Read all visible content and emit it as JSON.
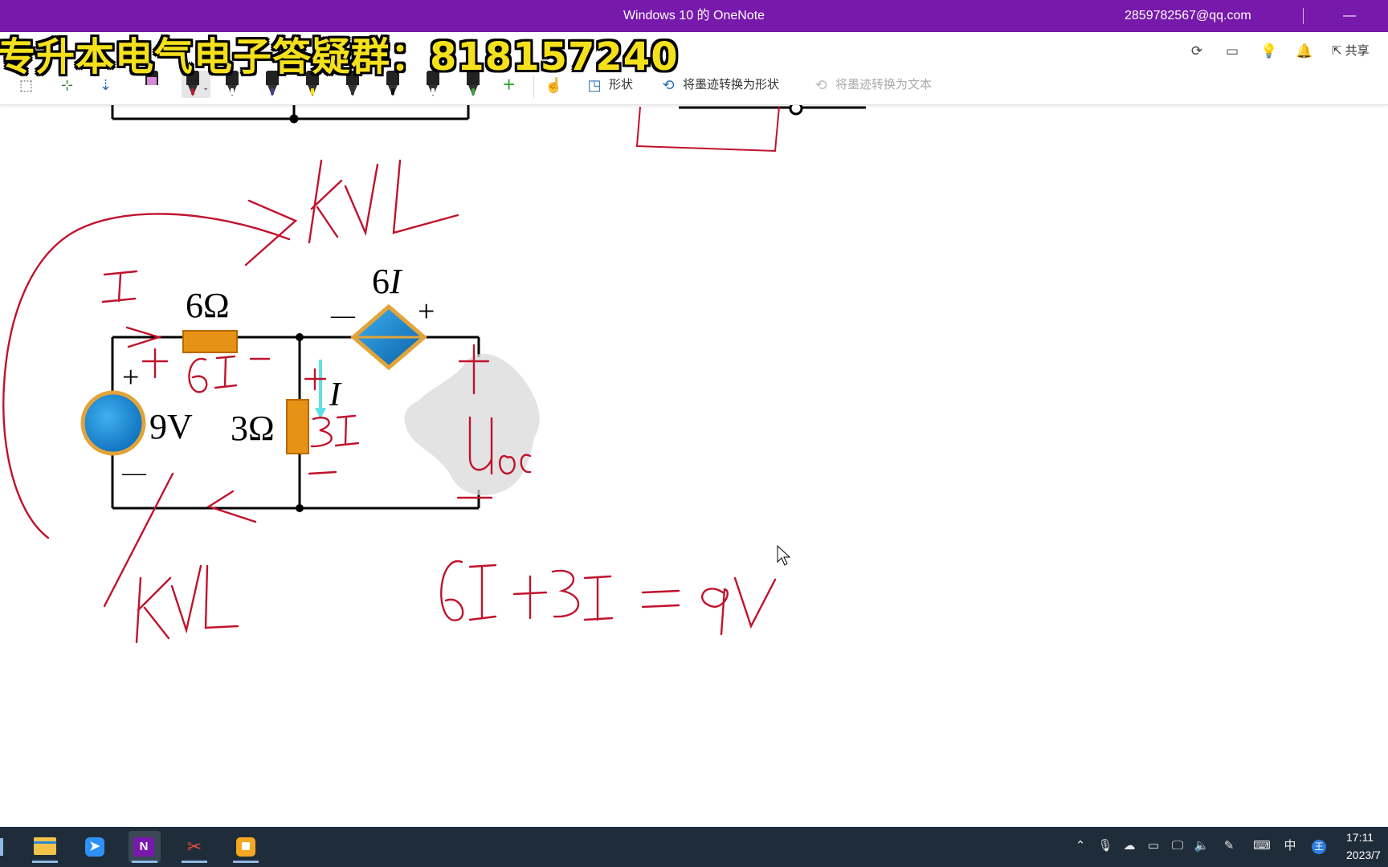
{
  "window": {
    "title": "Windows 10 的 OneNote",
    "account": "2859782567@qq.com",
    "minimize_glyph": "—"
  },
  "top_icons": [
    "sync-icon",
    "page-view-icon",
    "lightbulb-icon",
    "bell-icon"
  ],
  "share_label": "共享",
  "overlay_banner": "专升本电气电子答疑群：818157240",
  "ribbon": {
    "pens": [
      {
        "name": "lasso-select",
        "color": "#555555"
      },
      {
        "name": "space-insert",
        "color": "#2a7d2a"
      },
      {
        "name": "eraser",
        "color": "#2a6fb5"
      },
      {
        "name": "pen-purple",
        "color": "#c06bc8"
      },
      {
        "name": "pen-red",
        "color": "#c0132d"
      },
      {
        "name": "pen-black-1",
        "color": "#222222"
      },
      {
        "name": "pen-purple-2",
        "color": "#4b3b8f"
      },
      {
        "name": "highlighter-yellow",
        "color": "#f5e100"
      },
      {
        "name": "pen-black-2",
        "color": "#222222"
      },
      {
        "name": "pen-black-3",
        "color": "#111111"
      },
      {
        "name": "pen-black-4",
        "color": "#333333"
      },
      {
        "name": "pen-green",
        "color": "#3aa33a"
      }
    ],
    "add_pen_glyph": "+",
    "shape_label": "形状",
    "ink_to_shape_label": "将墨迹转换为形状",
    "ink_to_text_label": "将墨迹转换为文本"
  },
  "circuit": {
    "resistor_top_label": "6Ω",
    "resistor_mid_label": "3Ω",
    "source_label": "9V",
    "dependent_source_label": "6",
    "dependent_source_var": "I",
    "current_label": "I",
    "plus": "+",
    "minus": "—"
  },
  "annotations": {
    "kvl_top": "KVL",
    "kvl_bottom": "KVL",
    "current_I": "I",
    "v6": "6I",
    "v3": "3I",
    "uoc": "Uoc",
    "equation": "6I+3I=9V"
  },
  "taskbar": {
    "apps": [
      "file-explorer",
      "feishu",
      "onenote",
      "snipping-tool",
      "media-app"
    ],
    "tray_ime": "中",
    "clock_time": "17:11",
    "clock_date": "2023/7"
  }
}
